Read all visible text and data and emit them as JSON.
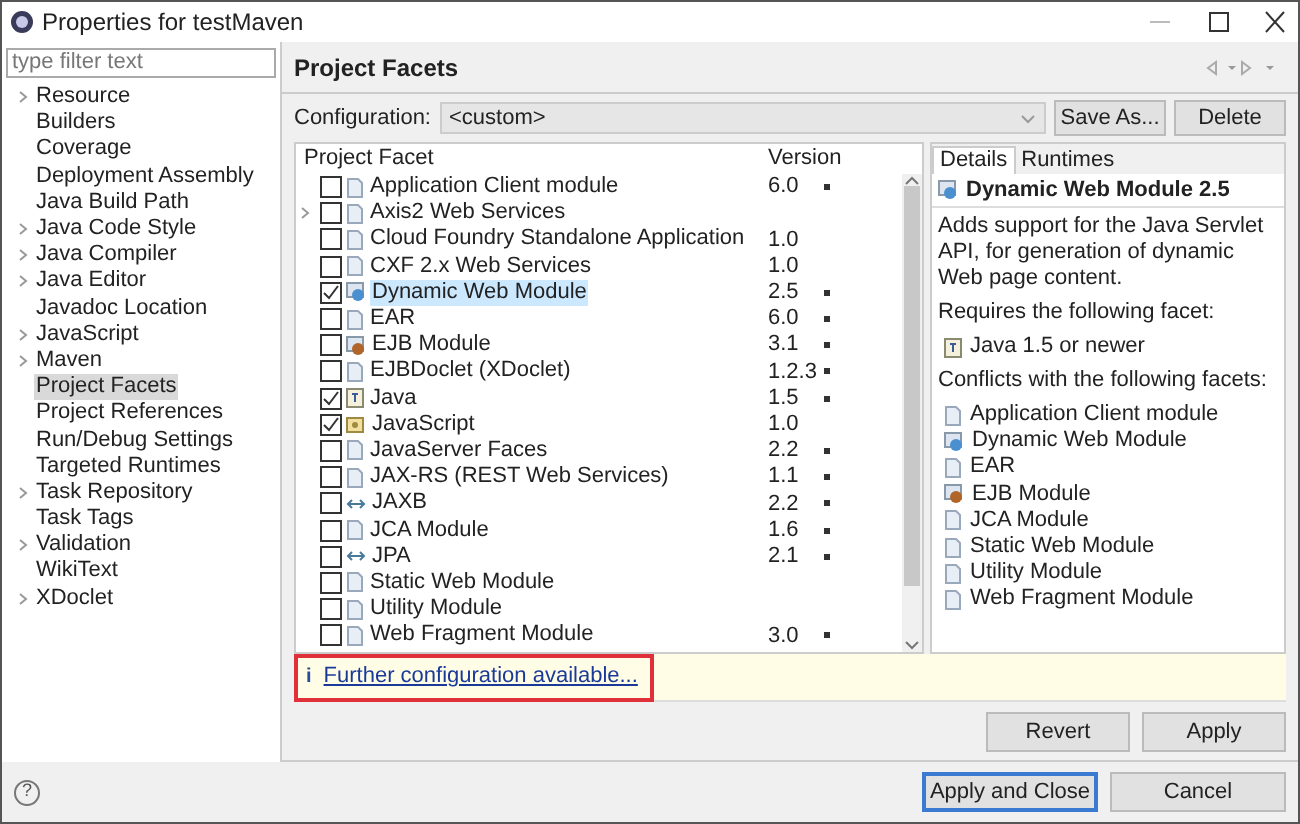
{
  "window": {
    "title": "Properties for testMaven"
  },
  "filter": {
    "placeholder": "type filter text"
  },
  "sidebar": {
    "items": [
      {
        "label": "Resource",
        "expandable": true,
        "selected": false
      },
      {
        "label": "Builders",
        "expandable": false,
        "selected": false
      },
      {
        "label": "Coverage",
        "expandable": false,
        "selected": false
      },
      {
        "label": "Deployment Assembly",
        "expandable": false,
        "selected": false
      },
      {
        "label": "Java Build Path",
        "expandable": false,
        "selected": false
      },
      {
        "label": "Java Code Style",
        "expandable": true,
        "selected": false
      },
      {
        "label": "Java Compiler",
        "expandable": true,
        "selected": false
      },
      {
        "label": "Java Editor",
        "expandable": true,
        "selected": false
      },
      {
        "label": "Javadoc Location",
        "expandable": false,
        "selected": false
      },
      {
        "label": "JavaScript",
        "expandable": true,
        "selected": false
      },
      {
        "label": "Maven",
        "expandable": true,
        "selected": false
      },
      {
        "label": "Project Facets",
        "expandable": false,
        "selected": true
      },
      {
        "label": "Project References",
        "expandable": false,
        "selected": false
      },
      {
        "label": "Run/Debug Settings",
        "expandable": false,
        "selected": false
      },
      {
        "label": "Targeted Runtimes",
        "expandable": false,
        "selected": false
      },
      {
        "label": "Task Repository",
        "expandable": true,
        "selected": false
      },
      {
        "label": "Task Tags",
        "expandable": false,
        "selected": false
      },
      {
        "label": "Validation",
        "expandable": true,
        "selected": false
      },
      {
        "label": "WikiText",
        "expandable": false,
        "selected": false
      },
      {
        "label": "XDoclet",
        "expandable": true,
        "selected": false
      }
    ]
  },
  "page": {
    "title": "Project Facets",
    "configuration_label": "Configuration:",
    "configuration_value": "<custom>",
    "buttons": [
      "Save As...",
      "Delete"
    ]
  },
  "table": {
    "columns": [
      "Project Facet",
      "Version"
    ],
    "rows": [
      {
        "name": "Application Client module",
        "version": "6.0",
        "kind": "doc",
        "checked": false,
        "selected": false,
        "expandable": false,
        "version_menu": true
      },
      {
        "name": "Axis2 Web Services",
        "kind": "doc",
        "checked": false,
        "selected": false,
        "expandable": true,
        "version_menu": false
      },
      {
        "name": "Cloud Foundry Standalone Application",
        "version": "1.0",
        "kind": "doc",
        "checked": false,
        "selected": false,
        "expandable": false,
        "version_menu": false
      },
      {
        "name": "CXF 2.x Web Services",
        "version": "1.0",
        "kind": "doc",
        "checked": false,
        "selected": false,
        "expandable": false,
        "version_menu": false
      },
      {
        "name": "Dynamic Web Module",
        "version": "2.5",
        "kind": "web",
        "checked": true,
        "selected": true,
        "expandable": false,
        "version_menu": true
      },
      {
        "name": "EAR",
        "version": "6.0",
        "kind": "doc",
        "checked": false,
        "selected": false,
        "expandable": false,
        "version_menu": true
      },
      {
        "name": "EJB Module",
        "version": "3.1",
        "kind": "ejb",
        "checked": false,
        "selected": false,
        "expandable": false,
        "version_menu": true
      },
      {
        "name": "EJBDoclet (XDoclet)",
        "version": "1.2.3",
        "kind": "doc",
        "checked": false,
        "selected": false,
        "expandable": false,
        "version_menu": true
      },
      {
        "name": "Java",
        "version": "1.5",
        "kind": "java",
        "checked": true,
        "selected": false,
        "expandable": false,
        "version_menu": true
      },
      {
        "name": "JavaScript",
        "version": "1.0",
        "kind": "js",
        "checked": true,
        "selected": false,
        "expandable": false,
        "version_menu": false
      },
      {
        "name": "JavaServer Faces",
        "version": "2.2",
        "kind": "doc",
        "checked": false,
        "selected": false,
        "expandable": false,
        "version_menu": true
      },
      {
        "name": "JAX-RS (REST Web Services)",
        "version": "1.1",
        "kind": "doc",
        "checked": false,
        "selected": false,
        "expandable": false,
        "version_menu": true
      },
      {
        "name": "JAXB",
        "version": "2.2",
        "kind": "arrows",
        "checked": false,
        "selected": false,
        "expandable": false,
        "version_menu": true
      },
      {
        "name": "JCA Module",
        "version": "1.6",
        "kind": "doc",
        "checked": false,
        "selected": false,
        "expandable": false,
        "version_menu": true
      },
      {
        "name": "JPA",
        "version": "2.1",
        "kind": "arrows",
        "checked": false,
        "selected": false,
        "expandable": false,
        "version_menu": true
      },
      {
        "name": "Static Web Module",
        "kind": "doc",
        "checked": false,
        "selected": false,
        "expandable": false,
        "version_menu": false
      },
      {
        "name": "Utility Module",
        "kind": "doc",
        "checked": false,
        "selected": false,
        "expandable": false,
        "version_menu": false
      },
      {
        "name": "Web Fragment Module",
        "version": "3.0",
        "kind": "doc",
        "checked": false,
        "selected": false,
        "expandable": false,
        "version_menu": true
      }
    ]
  },
  "details": {
    "tabs": [
      {
        "label": "Details",
        "selected": true
      },
      {
        "label": "Runtimes",
        "selected": false
      }
    ],
    "title": "Dynamic Web Module 2.5",
    "description": "Adds support for the Java Servlet API, for generation of dynamic Web page content.",
    "requires_label": "Requires the following facet:",
    "requires": [
      {
        "name": "Java 1.5 or newer",
        "kind": "java"
      }
    ],
    "conflicts_label": "Conflicts with the following facets:",
    "conflicts": [
      {
        "name": "Application Client module",
        "kind": "doc"
      },
      {
        "name": "Dynamic Web Module",
        "kind": "web"
      },
      {
        "name": "EAR",
        "kind": "doc"
      },
      {
        "name": "EJB Module",
        "kind": "ejb"
      },
      {
        "name": "JCA Module",
        "kind": "doc"
      },
      {
        "name": "Static Web Module",
        "kind": "doc"
      },
      {
        "name": "Utility Module",
        "kind": "doc"
      },
      {
        "name": "Web Fragment Module",
        "kind": "doc"
      }
    ]
  },
  "info": {
    "icon": "i",
    "link": "Further configuration available..."
  },
  "page_buttons": [
    "Revert",
    "Apply"
  ],
  "dialog_buttons": [
    {
      "label": "Apply and Close",
      "selected": true
    },
    {
      "label": "Cancel",
      "selected": false
    }
  ],
  "help": "?"
}
